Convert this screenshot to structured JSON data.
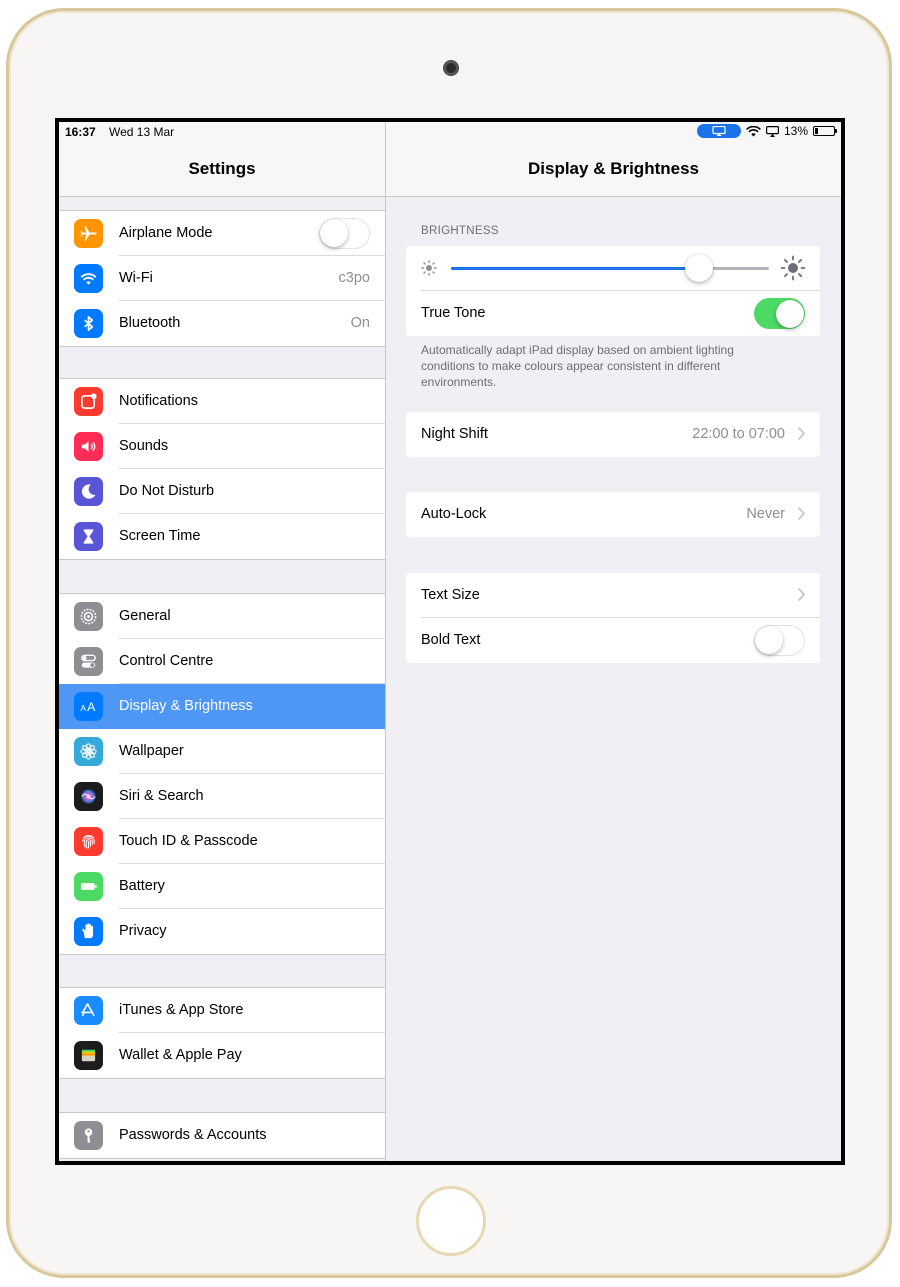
{
  "status_bar": {
    "time": "16:37",
    "date": "Wed 13 Mar",
    "battery": "13%"
  },
  "master": {
    "title": "Settings",
    "groups": [
      [
        {
          "label": "Airplane Mode",
          "icon": "airplane-icon",
          "color": "#ff9500",
          "toggle": "off"
        },
        {
          "label": "Wi-Fi",
          "icon": "wifi-icon",
          "color": "#007aff",
          "value": "c3po"
        },
        {
          "label": "Bluetooth",
          "icon": "bluetooth-icon",
          "color": "#007aff",
          "value": "On"
        }
      ],
      [
        {
          "label": "Notifications",
          "icon": "notifications-icon",
          "color": "#ff3b30"
        },
        {
          "label": "Sounds",
          "icon": "sounds-icon",
          "color": "#ff2d55"
        },
        {
          "label": "Do Not Disturb",
          "icon": "moon-icon",
          "color": "#5856d6"
        },
        {
          "label": "Screen Time",
          "icon": "hourglass-icon",
          "color": "#5856d6"
        }
      ],
      [
        {
          "label": "General",
          "icon": "gear-icon",
          "color": "#8e8e93"
        },
        {
          "label": "Control Centre",
          "icon": "switches-icon",
          "color": "#8e8e93"
        },
        {
          "label": "Display & Brightness",
          "icon": "text-size-icon",
          "color": "#007aff",
          "selected": true
        },
        {
          "label": "Wallpaper",
          "icon": "flower-icon",
          "color": "#34aadc"
        },
        {
          "label": "Siri & Search",
          "icon": "siri-icon",
          "color": "#1c1c1e"
        },
        {
          "label": "Touch ID & Passcode",
          "icon": "fingerprint-icon",
          "color": "#ff3b30"
        },
        {
          "label": "Battery",
          "icon": "battery-icon",
          "color": "#4cd964"
        },
        {
          "label": "Privacy",
          "icon": "hand-icon",
          "color": "#007aff"
        }
      ],
      [
        {
          "label": "iTunes & App Store",
          "icon": "app-store-icon",
          "color": "#1a8cff"
        },
        {
          "label": "Wallet & Apple Pay",
          "icon": "wallet-icon",
          "color": "#1c1c1e"
        }
      ],
      [
        {
          "label": "Passwords & Accounts",
          "icon": "key-icon",
          "color": "#8e8e93"
        }
      ]
    ]
  },
  "detail": {
    "title": "Display & Brightness",
    "brightness_header": "BRIGHTNESS",
    "brightness_level": 0.78,
    "true_tone_label": "True Tone",
    "true_tone_state": "on",
    "true_tone_footer": "Automatically adapt iPad display based on ambient lighting conditions to make colours appear consistent in different environments.",
    "night_shift_label": "Night Shift",
    "night_shift_value": "22:00 to 07:00",
    "auto_lock_label": "Auto-Lock",
    "auto_lock_value": "Never",
    "text_size_label": "Text Size",
    "bold_text_label": "Bold Text",
    "bold_text_state": "off"
  },
  "colors": {
    "accent": "#1a73e8",
    "toggle_on": "#4cd964",
    "selected_row": "#4f97f5"
  }
}
